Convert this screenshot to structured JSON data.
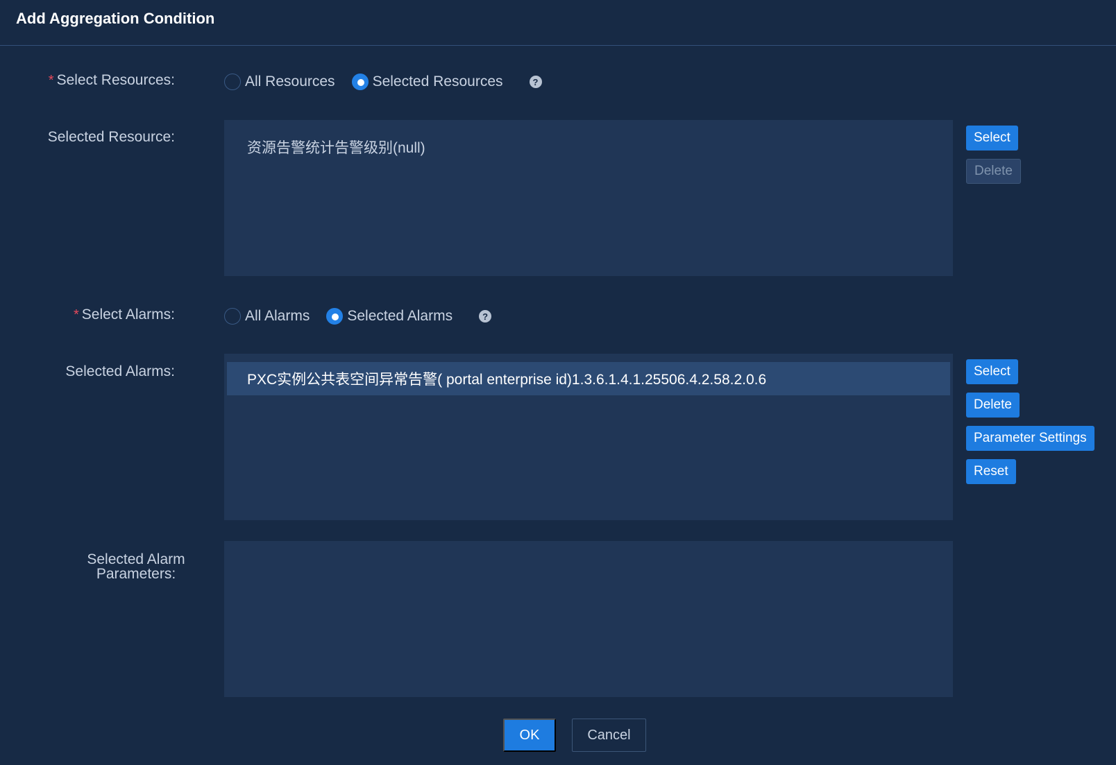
{
  "dialog": {
    "title": "Add Aggregation Condition"
  },
  "select_resources": {
    "label": "Select Resources:",
    "required": "*",
    "options": [
      "All Resources",
      "Selected Resources"
    ],
    "selected": "Selected Resources",
    "help": "?"
  },
  "selected_resource": {
    "label": "Selected Resource:",
    "items": [
      "资源告警统计告警级别(null)"
    ],
    "buttons": {
      "select": "Select",
      "delete": "Delete"
    }
  },
  "select_alarms": {
    "label": "Select Alarms:",
    "required": "*",
    "options": [
      "All Alarms",
      "Selected Alarms"
    ],
    "selected": "Selected Alarms",
    "help": "?"
  },
  "selected_alarms": {
    "label": "Selected Alarms:",
    "items": [
      "PXC实例公共表空间异常告警( portal enterprise id)1.3.6.1.4.1.25506.4.2.58.2.0.6"
    ],
    "buttons": {
      "select": "Select",
      "delete": "Delete",
      "parameter_settings": "Parameter Settings",
      "reset": "Reset"
    }
  },
  "alarm_parameters": {
    "label": "Selected Alarm Parameters:",
    "items": []
  },
  "footer": {
    "ok": "OK",
    "cancel": "Cancel"
  },
  "colors": {
    "background": "#172a45",
    "panel": "#203656",
    "accent": "#1e7ce0",
    "required": "#e6495b"
  }
}
